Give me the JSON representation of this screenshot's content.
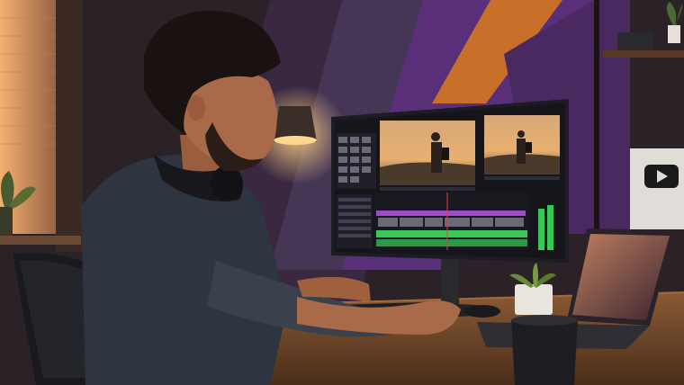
{
  "scene": {
    "description_free": true,
    "colors": {
      "wall_dark": "#2a2226",
      "wall_purple": "#5a2f7a",
      "wall_orange": "#c8702a",
      "window_glow": "#f0a060",
      "desk": "#6a4428",
      "monitor_frame": "#1c1c22",
      "timeline_purple": "#a04cc8",
      "timeline_green": "#38c858",
      "lamp_glow": "#ffc070",
      "shirt": "#2e3440",
      "skin": "#a86a48",
      "hair": "#1a1210"
    },
    "icons": [
      "youtube-play-icon"
    ]
  }
}
